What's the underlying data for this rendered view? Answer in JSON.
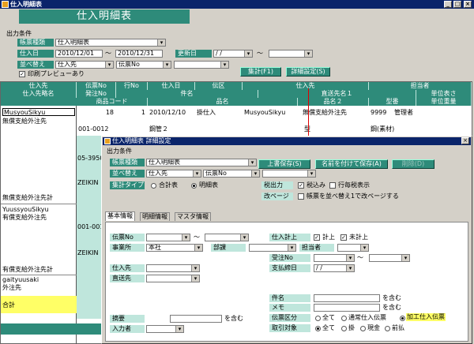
{
  "window": {
    "title": "仕入明細表",
    "min": "_",
    "max": "□",
    "close": "×"
  },
  "banner": {
    "title": "仕入明細表"
  },
  "conditions": {
    "heading": "出力条件",
    "form_type_label": "帳票種類",
    "form_type_value": "仕入明細表",
    "purchase_date_label": "仕入日",
    "date_from": "2010/12/01",
    "date_to": "2010/12/31",
    "tilde": "～",
    "updated_label": "更新日",
    "updated_from": " /  /",
    "updated_to": "",
    "sort_label": "並べ替え",
    "sort1": "仕入先",
    "sort2": "伝票No",
    "sort3": "",
    "preview_label": "印刷プレビューあり",
    "preview_checked": "✓",
    "total_button": "集計(F1)",
    "detail_button": "詳細設定(S)"
  },
  "grid": {
    "header_row1": [
      "仕入先",
      "伝票No",
      "行No",
      "仕入日",
      "伝区",
      "仕入先",
      "担当者"
    ],
    "header_row2": [
      "仕入先略名",
      "発注No",
      "件名",
      "直送先名１",
      "単位表さ"
    ],
    "header_row3": [
      "商品コード",
      "品名",
      "品名２",
      "型番",
      "単位重量"
    ],
    "left_column": [
      "MusyouSikyu",
      "無償支給外注先",
      "無償支給外注先計",
      "YuussyouSikyu",
      "有償支給外注先",
      "有償支給外注先計",
      "gaityuusaki",
      "外注先",
      "合計"
    ],
    "row1": {
      "denno": "18",
      "gyono": "1",
      "date": "2010/12/10",
      "kubun": "掛仕入",
      "shiiresaki_code": "MusyouSikyu",
      "shiiresaki_name": "無償支給外注先",
      "tanto_code": "9999",
      "tanto_name": "管理者"
    },
    "row2": {
      "item": "001-0012",
      "hinmei": "鋼管２",
      "hinmei2": "型",
      "unit": "鋼(素材)"
    },
    "partial_codes": [
      "05-3950",
      "ZEIKIN",
      "001-001",
      "ZEIKIN"
    ]
  },
  "dialog": {
    "title": "仕入明細表 詳細設定",
    "close": "×",
    "heading": "出力条件",
    "form_type_label": "帳票種類",
    "form_type_value": "仕入明細表",
    "sort_label": "並べ替え",
    "sort1": "仕入先",
    "sort2": "伝票No",
    "sort3": "",
    "total_type_label": "集計タイプ",
    "total_opt1": "合計表",
    "total_opt2": "明細表",
    "overwrite_button": "上書保存(S)",
    "saveas_button": "名前を付けて保存(A)",
    "delete_button": "削除(D)",
    "tax_out_label": "税出力",
    "tax_incl_label": "税込み",
    "tax_line_label": "行毎税表示",
    "pagebreak_label": "改ページ",
    "pagebreak_text": "帳票を並べ替え1で改ページする",
    "tabs": [
      "基本情報",
      "明細情報",
      "マスタ情報"
    ],
    "basic": {
      "denno_label": "伝票No",
      "office_label": "事業所",
      "office_value": "本社",
      "dept_label": "部課",
      "supplier_label": "仕入先",
      "direct_label": "直送先",
      "summary_label": "摘要",
      "summary_suffix": "を含む",
      "inputter_label": "入力者",
      "posting_label": "仕入計上",
      "posted_label": "計上",
      "unposted_label": "未計上",
      "tanto_label": "担当者",
      "order_label": "受注No",
      "payday_label": "支払締日",
      "payday_value": " /  /",
      "subject_label": "件名",
      "subject_suffix": "を含む",
      "memo_label": "メモ",
      "memo_suffix": "を含む",
      "slip_type_label": "伝票区分",
      "slip_opts": [
        "全て",
        "通常仕入伝票",
        "加工仕入伝票"
      ],
      "deal_label": "取引対象",
      "deal_opts": [
        "全て",
        "掛",
        "現金",
        "前払"
      ]
    }
  },
  "colors": {
    "accent": "#2e8b7a",
    "titlebar": "#0a246a",
    "highlight": "#ffff66"
  }
}
